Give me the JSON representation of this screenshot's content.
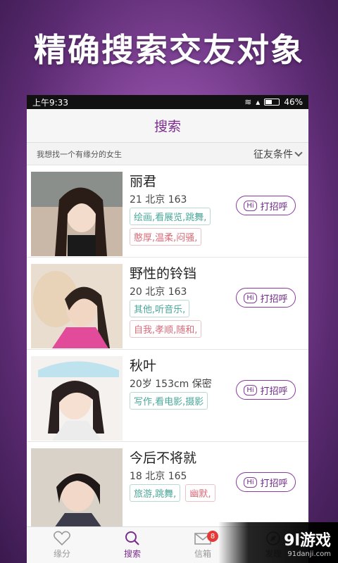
{
  "banner": {
    "title": "精确搜索交友对象"
  },
  "status": {
    "time": "上午9:33",
    "battery": "46%"
  },
  "nav": {
    "title": "搜索"
  },
  "filter": {
    "hint": "我想找一个有缘分的女生",
    "button": "征友条件"
  },
  "cards": [
    {
      "name": "丽君",
      "meta": "21 北京 163",
      "tags_green": [
        "绘画,看展览,跳舞,"
      ],
      "tags_pink": [
        "憨厚,温柔,闷骚,"
      ],
      "action": "打招呼",
      "hi": "Hi"
    },
    {
      "name": "野性的铃铛",
      "meta": "20 北京 163",
      "tags_green": [
        "其他,听音乐,"
      ],
      "tags_pink": [
        "自我,孝顺,随和,"
      ],
      "action": "打招呼",
      "hi": "Hi"
    },
    {
      "name": "秋叶",
      "meta": "20岁 153cm 保密",
      "tags_green": [
        "写作,看电影,摄影"
      ],
      "tags_pink": [],
      "action": "打招呼",
      "hi": "Hi"
    },
    {
      "name": "今后不将就",
      "meta": "18 北京 165",
      "tags_green": [
        "旅游,跳舞,"
      ],
      "tags_pink": [
        "幽默,"
      ],
      "action": "打招呼",
      "hi": "Hi"
    }
  ],
  "tabs": [
    {
      "label": "缘分",
      "icon": "heart-icon"
    },
    {
      "label": "搜索",
      "icon": "search-icon",
      "active": true
    },
    {
      "label": "信箱",
      "icon": "mail-icon",
      "badge": "8"
    },
    {
      "label": "发现",
      "icon": "compass-icon"
    }
  ],
  "watermark": {
    "main": "9l游戏",
    "sub": "91danji.com"
  },
  "colors": {
    "accent": "#7b2d8e",
    "tag_green": "#4aa89a",
    "tag_pink": "#d96b79"
  }
}
